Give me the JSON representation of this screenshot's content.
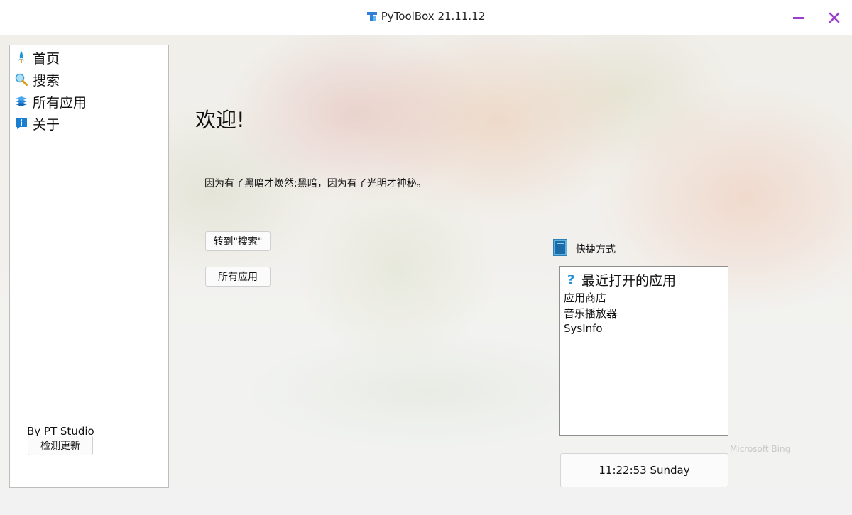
{
  "window": {
    "title": "PyToolBox 21.11.12",
    "minimize_icon": "minimize-icon",
    "close_icon": "close-icon",
    "accent": "#9a3fc9"
  },
  "sidebar": {
    "items": [
      {
        "label": "首页",
        "icon": "rocket-icon"
      },
      {
        "label": "搜索",
        "icon": "magnifier-icon"
      },
      {
        "label": "所有应用",
        "icon": "layers-icon"
      },
      {
        "label": "关于",
        "icon": "info-icon"
      }
    ],
    "credit": "By PT Studio",
    "check_update_label": "检测更新"
  },
  "main": {
    "welcome": "欢迎!",
    "quote": "因为有了黑暗才焕然;黑暗，因为有了光明才神秘。",
    "goto_search_label": "转到\"搜索\"",
    "all_apps_label": "所有应用"
  },
  "shortcuts": {
    "label": "快捷方式",
    "icon": "shortcut-panel-icon",
    "list_header": "最近打开的应用",
    "list_header_icon": "question-icon",
    "items": [
      "应用商店",
      "音乐播放器",
      "SysInfo"
    ]
  },
  "clock": {
    "text": "11:22:53 Sunday"
  },
  "background": {
    "watermark": "Microsoft Bing"
  }
}
